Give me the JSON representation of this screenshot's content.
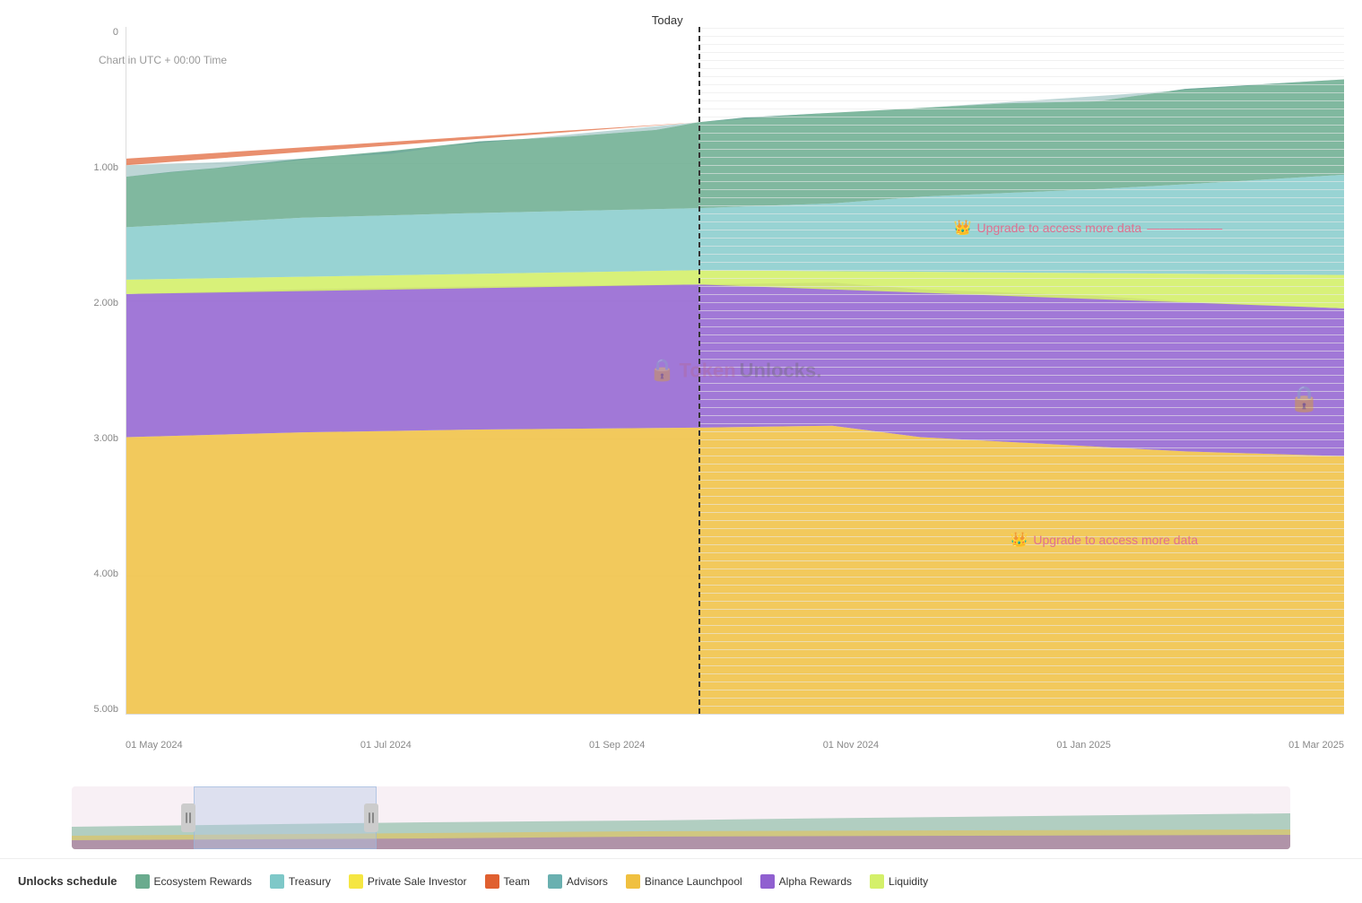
{
  "chart": {
    "title": "Unlocks schedule",
    "subtitle": "Chart in UTC + 00:00 Time",
    "today_label": "Today",
    "upgrade_message": "Upgrade to access more data",
    "watermark": "TokenUnlocks.",
    "y_axis": {
      "labels": [
        "0",
        "1.00b",
        "2.00b",
        "3.00b",
        "4.00b",
        "5.00b"
      ]
    },
    "x_axis": {
      "labels": [
        "01 May 2024",
        "01 Jul 2024",
        "01 Sep 2024",
        "01 Nov 2024",
        "01 Jan 2025",
        "01 Mar 2025"
      ]
    }
  },
  "legend": {
    "items": [
      {
        "label": "Unlocks schedule",
        "color": "transparent",
        "text_only": true
      },
      {
        "label": "Ecosystem Rewards",
        "color": "#6aab8e"
      },
      {
        "label": "Treasury",
        "color": "#7ec8c8"
      },
      {
        "label": "Private Sale Investor",
        "color": "#f5e642"
      },
      {
        "label": "Team",
        "color": "#e06030"
      },
      {
        "label": "Advisors",
        "color": "#6ab0b0"
      },
      {
        "label": "Binance Launchpool",
        "color": "#f0c040"
      },
      {
        "label": "Alpha Rewards",
        "color": "#9060d0"
      },
      {
        "label": "Liquidity",
        "color": "#d4f06a"
      }
    ]
  }
}
